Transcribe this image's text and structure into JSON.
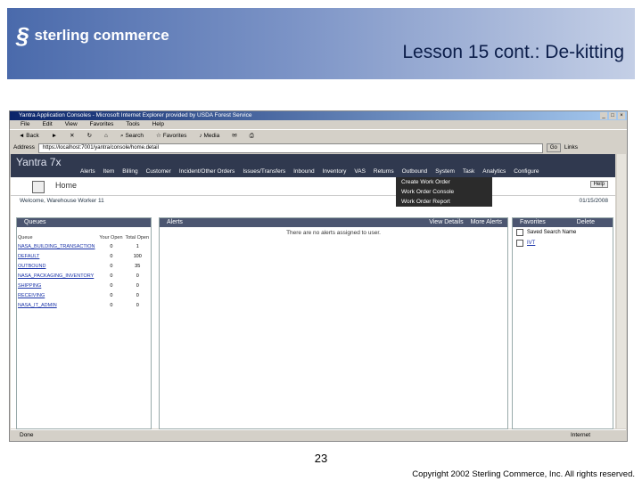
{
  "slide": {
    "logo_text": "sterling commerce",
    "title": "Lesson 15 cont.: De-kitting",
    "page_number": "23",
    "copyright": "Copyright 2002 Sterling Commerce, Inc. All rights reserved."
  },
  "browser": {
    "window_title": "Yantra Application Consoles - Microsoft Internet Explorer provided by USDA Forest Service",
    "menu": [
      "File",
      "Edit",
      "View",
      "Favorites",
      "Tools",
      "Help"
    ],
    "toolbar": [
      "Back",
      "Search",
      "Favorites",
      "Media"
    ],
    "address_label": "Address",
    "address": "https://localhost:7001/yantra/console/home.detail",
    "go_label": "Go",
    "links_label": "Links",
    "status_left": "Done",
    "status_right": "Internet"
  },
  "app": {
    "brand": "Yantra 7x",
    "nav": [
      "Alerts",
      "Item",
      "Billing",
      "Customer",
      "Incident/Other Orders",
      "Issues/Transfers",
      "Inbound",
      "Inventory",
      "VAS",
      "Returns",
      "Outbound",
      "System",
      "Task",
      "Analytics",
      "Configure"
    ],
    "dropdown": [
      "Create Work Order",
      "Work Order Console",
      "Work Order Report"
    ],
    "home_title": "Home",
    "help": "Help",
    "welcome": "Welcome, Warehouse Worker 11",
    "date": "01/15/2008",
    "queues": {
      "title": "Queues",
      "col_name": "Queue",
      "col_your": "Your Open",
      "col_total": "Total Open",
      "rows": [
        {
          "name": "NASA_BUILDING_TRANSACTION",
          "your": "0",
          "total": "1"
        },
        {
          "name": "DEFAULT",
          "your": "0",
          "total": "100"
        },
        {
          "name": "OUTBOUND",
          "your": "0",
          "total": "35"
        },
        {
          "name": "NASA_PACKAGING_INVENTORY",
          "your": "0",
          "total": "0"
        },
        {
          "name": "SHIPPING",
          "your": "0",
          "total": "0"
        },
        {
          "name": "RECEIVING",
          "your": "0",
          "total": "0"
        },
        {
          "name": "NASA_IT_ADMIN",
          "your": "0",
          "total": "0"
        }
      ]
    },
    "alerts": {
      "title": "Alerts",
      "view_details": "View Details",
      "more_alerts": "More Alerts",
      "empty_message": "There are no alerts assigned to user."
    },
    "favorites": {
      "title": "Favorites",
      "delete": "Delete",
      "header": "Saved Search Name",
      "items": [
        "IVT"
      ]
    }
  }
}
